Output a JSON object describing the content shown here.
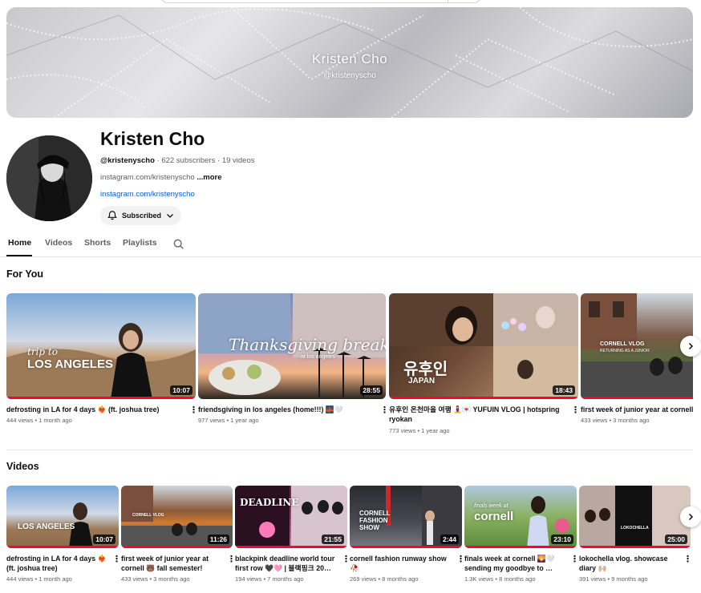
{
  "banner": {
    "name": "Kristen Cho",
    "handle": "@kristenyscho"
  },
  "channel": {
    "name": "Kristen Cho",
    "handle": "@kristenyscho",
    "stats": "· 622 subscribers · 19 videos",
    "description": "instagram.com/kristenyscho",
    "more": "...more",
    "link": "instagram.com/kristenyscho",
    "subscribe_label": "Subscribed"
  },
  "tabs": [
    {
      "label": "Home"
    },
    {
      "label": "Videos"
    },
    {
      "label": "Shorts"
    },
    {
      "label": "Playlists"
    }
  ],
  "for_you": {
    "title": "For You",
    "videos": [
      {
        "title": "defrosting in LA for 4 days ❤️‍🔥 (ft. joshua tree)",
        "views": "444 views",
        "age": "1 month ago",
        "duration": "10:07",
        "overlay": "LOS ANGELES",
        "overlay2": "trip to"
      },
      {
        "title": "friendsgiving in los angeles (home!!!) 🌉🤍",
        "views": "977 views",
        "age": "1 year ago",
        "duration": "28:55",
        "overlay": "Thanksgiving break",
        "overlay2": "at los angeles"
      },
      {
        "title": "유후인 온천마을 여행 🧘‍♀️💌 YUFUIN VLOG | hotspring ryokan",
        "views": "773 views",
        "age": "1 year ago",
        "duration": "18:43",
        "overlay": "유후인",
        "overlay2": "JAPAN"
      },
      {
        "title": "first week of junior year at cornell",
        "views": "433 views",
        "age": "3 months ago",
        "duration": "",
        "overlay": "CORNELL VLOG",
        "overlay2": "RETURNING AS A JUNIOR"
      }
    ]
  },
  "videos_section": {
    "title": "Videos",
    "videos": [
      {
        "title": "defrosting in LA for 4 days ❤️‍🔥 (ft. joshua tree)",
        "views": "444 views",
        "age": "1 month ago",
        "duration": "10:07",
        "overlay": "LOS ANGELES"
      },
      {
        "title": "first week of junior year at cornell 🐻 fall semester!",
        "views": "433 views",
        "age": "3 months ago",
        "duration": "11:26",
        "overlay": "CORNELL VLOG"
      },
      {
        "title": "blackpink deadline world tour first row 🖤🩷 | 블랙핑크 20…",
        "views": "194 views",
        "age": "7 months ago",
        "duration": "21:55",
        "overlay": "DEADLINE"
      },
      {
        "title": "cornell fashion runway show 🥀",
        "views": "269 views",
        "age": "8 months ago",
        "duration": "2:44",
        "overlay": "CORNELL FASHION SHOW"
      },
      {
        "title": "finals week at cornell 🌄🤍 sending my goodbye to …",
        "views": "1.3K views",
        "age": "8 months ago",
        "duration": "23:10",
        "overlay": "cornell"
      },
      {
        "title": "lokochella vlog. showcase diary 🙌🏼",
        "views": "391 views",
        "age": "9 months ago",
        "duration": "25:00",
        "overlay": "LOKOCHELLA"
      }
    ]
  },
  "colors": {
    "accent": "#ff0033",
    "link": "#065fd4",
    "muted": "#606060"
  },
  "icons": {
    "bell": "bell-icon",
    "chevron": "chevron-down-icon",
    "search": "search-icon",
    "next": "chevron-right-icon",
    "more": "more-vert-icon"
  }
}
